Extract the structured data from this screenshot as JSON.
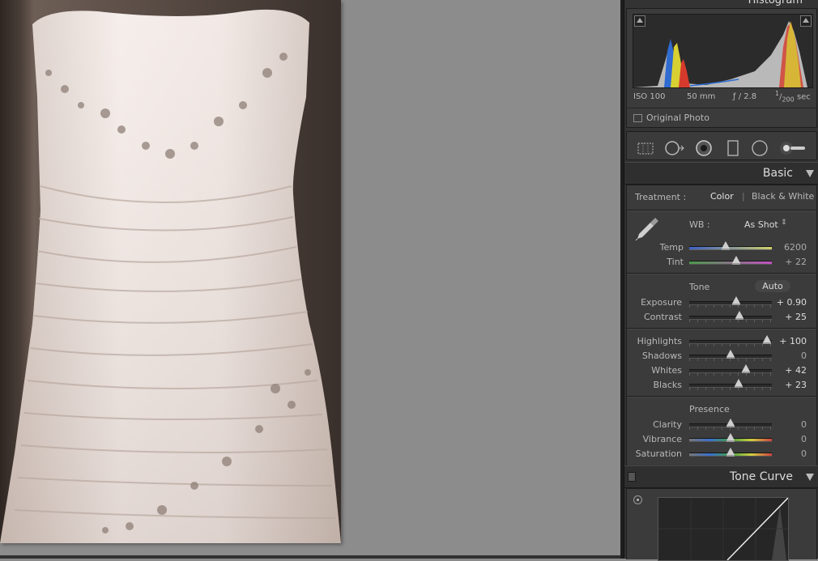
{
  "histogram": {
    "title": "Histogram",
    "iso": "ISO 100",
    "focal": "50 mm",
    "aperture": "ƒ / 2.8",
    "shutter_num": "1",
    "shutter_den": "200",
    "shutter_unit": "sec",
    "original_photo": "Original Photo"
  },
  "tools": [
    "crop-overlay-icon",
    "spot-removal-icon",
    "red-eye-icon",
    "graduated-filter-icon",
    "radial-filter-icon",
    "adjustment-brush-icon"
  ],
  "basic": {
    "title": "Basic",
    "treatment_label": "Treatment :",
    "treatment_color": "Color",
    "treatment_sep": "|",
    "treatment_bw": "Black & White",
    "wb_label": "WB :",
    "wb_value": "As Shot",
    "wb_arrows": "⇕",
    "tone_label": "Tone",
    "auto_label": "Auto",
    "presence_label": "Presence",
    "sliders": {
      "temp": {
        "label": "Temp",
        "value": "6200",
        "pos": 0.44
      },
      "tint": {
        "label": "Tint",
        "value": "+ 22",
        "pos": 0.57
      },
      "exposure": {
        "label": "Exposure",
        "value": "+ 0.90",
        "pos": 0.57
      },
      "contrast": {
        "label": "Contrast",
        "value": "+ 25",
        "pos": 0.61
      },
      "highlights": {
        "label": "Highlights",
        "value": "+ 100",
        "pos": 0.94
      },
      "shadows": {
        "label": "Shadows",
        "value": "0",
        "pos": 0.5
      },
      "whites": {
        "label": "Whites",
        "value": "+ 42",
        "pos": 0.69
      },
      "blacks": {
        "label": "Blacks",
        "value": "+ 23",
        "pos": 0.6
      },
      "clarity": {
        "label": "Clarity",
        "value": "0",
        "pos": 0.5
      },
      "vibrance": {
        "label": "Vibrance",
        "value": "0",
        "pos": 0.5
      },
      "saturation": {
        "label": "Saturation",
        "value": "0",
        "pos": 0.5
      }
    }
  },
  "tone_curve": {
    "title": "Tone Curve"
  },
  "colors": {
    "panel_bg": "#333333",
    "box_bg": "#3b3b3b",
    "accent_text": "#dcdcdc"
  }
}
